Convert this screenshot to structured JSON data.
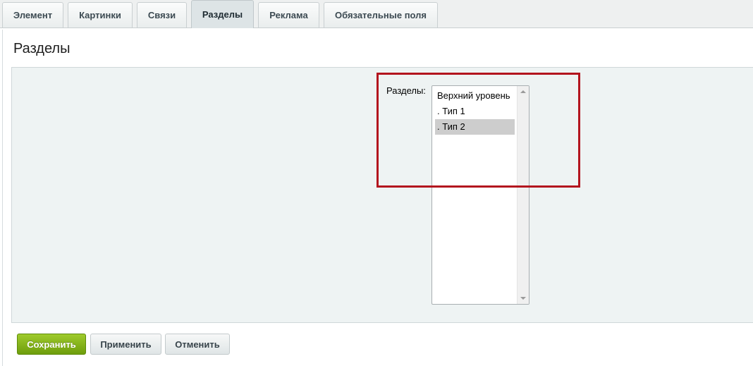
{
  "tabs": [
    {
      "label": "Элемент",
      "active": false
    },
    {
      "label": "Картинки",
      "active": false
    },
    {
      "label": "Связи",
      "active": false
    },
    {
      "label": "Разделы",
      "active": true
    },
    {
      "label": "Реклама",
      "active": false
    },
    {
      "label": "Обязательные поля",
      "active": false
    }
  ],
  "page": {
    "title": "Разделы"
  },
  "sections_field": {
    "label": "Разделы:",
    "options": [
      {
        "label": "Верхний уровень",
        "selected": false
      },
      {
        "label": ". Тип 1",
        "selected": false
      },
      {
        "label": ". Тип 2",
        "selected": true
      }
    ]
  },
  "buttons": {
    "save": "Сохранить",
    "apply": "Применить",
    "cancel": "Отменить"
  },
  "colors": {
    "highlight_frame": "#b3141e",
    "save_button": "#84b31a",
    "selected_option": "#cdcdcd",
    "form_background": "#eef3f3"
  },
  "icons": {
    "scroll_up": "triangle-up",
    "scroll_down": "triangle-down"
  }
}
